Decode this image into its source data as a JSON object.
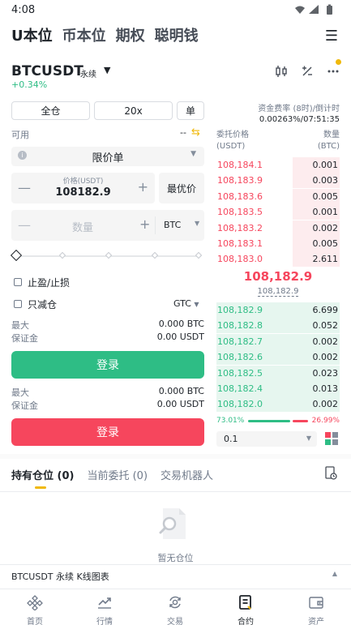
{
  "status": {
    "time": "4:08"
  },
  "top_tabs": [
    "U本位",
    "币本位",
    "期权",
    "聪明钱"
  ],
  "symbol": {
    "name": "BTCUSDT",
    "type": "永续",
    "change": "+0.34%"
  },
  "order_form": {
    "margin_mode": "全仓",
    "leverage": "20x",
    "position_mode": "单",
    "available_label": "可用",
    "available_value": "--",
    "order_type": "限价单",
    "price_label": "价格(USDT)",
    "price_value": "108182.9",
    "best_price": "最优价",
    "quantity_placeholder": "数量",
    "quantity_unit": "BTC",
    "tpsl_label": "止盈/止损",
    "reduce_only_label": "只减仓",
    "time_in_force": "GTC",
    "buy": {
      "max_label": "最大",
      "max_value": "0.000 BTC",
      "margin_label": "保证金",
      "margin_value": "0.00 USDT",
      "button": "登录"
    },
    "sell": {
      "max_label": "最大",
      "max_value": "0.000 BTC",
      "margin_label": "保证金",
      "margin_value": "0.00 USDT",
      "button": "登录"
    }
  },
  "order_book": {
    "funding_label": "资金费率 (8时)/倒计时",
    "funding_value": "0.00263%/07:51:35",
    "price_header": "委托价格",
    "price_unit": "(USDT)",
    "qty_header": "数量",
    "qty_unit": "(BTC)",
    "asks": [
      {
        "price": "108,184.1",
        "qty": "0.001",
        "depth": 0.38
      },
      {
        "price": "108,183.9",
        "qty": "0.003",
        "depth": 0.38
      },
      {
        "price": "108,183.6",
        "qty": "0.005",
        "depth": 0.38
      },
      {
        "price": "108,183.5",
        "qty": "0.001",
        "depth": 0.38
      },
      {
        "price": "108,183.2",
        "qty": "0.002",
        "depth": 0.38
      },
      {
        "price": "108,183.1",
        "qty": "0.005",
        "depth": 0.38
      },
      {
        "price": "108,183.0",
        "qty": "2.611",
        "depth": 0.38
      }
    ],
    "mid_price": "108,182.9",
    "mark_price": "108,182.9",
    "bids": [
      {
        "price": "108,182.9",
        "qty": "6.699",
        "depth": 1.0
      },
      {
        "price": "108,182.8",
        "qty": "0.052",
        "depth": 1.0
      },
      {
        "price": "108,182.7",
        "qty": "0.002",
        "depth": 1.0
      },
      {
        "price": "108,182.6",
        "qty": "0.002",
        "depth": 1.0
      },
      {
        "price": "108,182.5",
        "qty": "0.023",
        "depth": 1.0
      },
      {
        "price": "108,182.4",
        "qty": "0.013",
        "depth": 1.0
      },
      {
        "price": "108,182.0",
        "qty": "0.002",
        "depth": 1.0
      }
    ],
    "buy_ratio": "73.01%",
    "sell_ratio": "26.99%",
    "precision": "0.1"
  },
  "positions": {
    "tabs": [
      "持有仓位 (0)",
      "当前委托 (0)",
      "交易机器人"
    ],
    "empty_text": "暂无仓位",
    "kline_bar": "BTCUSDT 永续 K线图表"
  },
  "bottom_nav": [
    "首页",
    "行情",
    "交易",
    "合约",
    "资产"
  ],
  "colors": {
    "buy": "#2ebd85",
    "sell": "#f6465d",
    "accent": "#f0b90b"
  }
}
